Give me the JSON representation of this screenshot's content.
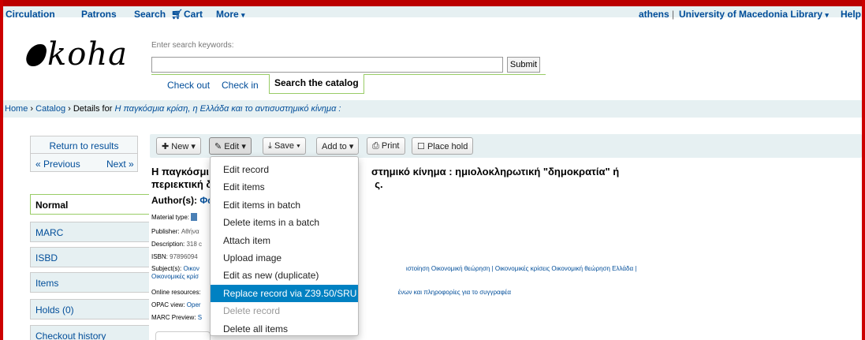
{
  "topnav": {
    "items": [
      "Circulation",
      "Patrons",
      "Search",
      "Cart",
      "More"
    ],
    "user": "athens",
    "library": "University of Macedonia Library",
    "help": "Help",
    "cart_icon": "cart-icon"
  },
  "header": {
    "logo": "koha",
    "search_hint": "Enter search keywords:",
    "search_value": "",
    "submit_label": "Submit",
    "tabs": [
      "Check out",
      "Check in",
      "Search the catalog"
    ]
  },
  "breadcrumb": {
    "home": "Home",
    "catalog": "Catalog",
    "details_prefix": "Details for",
    "title": "Η παγκόσμια κρίση, η Ελλάδα και το αντισυστημικό κίνημα :"
  },
  "sidebar": {
    "return": "Return to results",
    "previous": "« Previous",
    "next": "Next »",
    "tabs": [
      "Normal",
      "MARC",
      "ISBD",
      "Items",
      "Holds (0)",
      "Checkout history"
    ]
  },
  "toolbar": {
    "new": "New",
    "edit": "Edit",
    "save": "Save",
    "add_to": "Add to",
    "print": "Print",
    "place_hold": "Place hold"
  },
  "record": {
    "title_line1_start": "Η παγκόσμι",
    "title_line1_end": "στημικό κίνημα : ημιολοκληρωτική \"δημοκρατία\" ή",
    "title_line2_start": "περιεκτική δ",
    "title_line2_end": "ς.",
    "author_label": "Author(s):",
    "author_value": "Φω",
    "material_type": "Material type:",
    "publisher_label": "Publisher:",
    "publisher_value": "Αθήνα",
    "description_label": "Description:",
    "description_value": "318 c",
    "isbn_label": "ISBN:",
    "isbn_value": "97896094",
    "subjects_label": "Subject(s):",
    "subjects_start": "Οικον",
    "subjects_end": "ιστοίηση Οικονομική θεώρηση | Οικονομικές κρίσεις Οικονομική θεώρηση Ελλάδα |",
    "subjects_line2": "Οικονομικές κρίσ",
    "online_label": "Online resources:",
    "online_end": "ένων και πληροφορίες για το συγγραφέα",
    "opac_label": "OPAC view:",
    "opac_value": "Oper",
    "marc_label": "MARC Preview:",
    "marc_value": "S"
  },
  "edit_menu": {
    "items": [
      {
        "label": "Edit record",
        "state": "normal"
      },
      {
        "label": "Edit items",
        "state": "normal"
      },
      {
        "label": "Edit items in batch",
        "state": "normal"
      },
      {
        "label": "Delete items in a batch",
        "state": "normal"
      },
      {
        "label": "Attach item",
        "state": "normal"
      },
      {
        "label": "Upload image",
        "state": "normal"
      },
      {
        "label": "Edit as new (duplicate)",
        "state": "normal"
      },
      {
        "label": "Replace record via Z39.50/SRU",
        "state": "active"
      },
      {
        "label": "Delete record",
        "state": "disabled"
      },
      {
        "label": "Delete all items",
        "state": "normal"
      }
    ]
  },
  "colors": {
    "link": "#004d99",
    "nav_bg": "#e6f0f2",
    "menu_highlight": "#0081c2",
    "frame_red": "#cc0000"
  }
}
